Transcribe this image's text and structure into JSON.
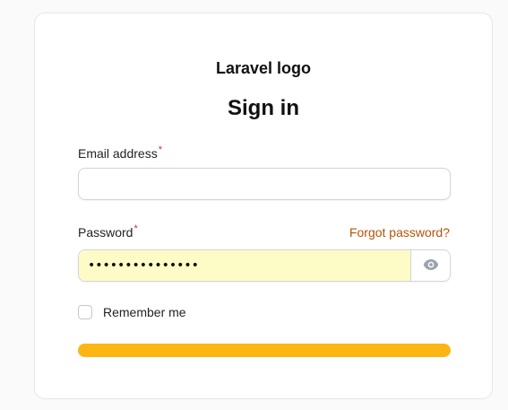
{
  "logo": {
    "alt_text": "Laravel logo"
  },
  "heading": "Sign in",
  "email": {
    "label": "Email address",
    "required_marker": "*",
    "value": ""
  },
  "password": {
    "label": "Password",
    "required_marker": "*",
    "value": "•••••••••••••••",
    "forgot_link": "Forgot password?",
    "toggle_icon": "eye-icon"
  },
  "remember": {
    "label": "Remember me",
    "checked": false
  },
  "submit": {
    "label": ""
  },
  "colors": {
    "accent": "#fbb614",
    "link": "#b45309",
    "autofill_bg": "#fefcc6",
    "required": "#dc2626"
  }
}
